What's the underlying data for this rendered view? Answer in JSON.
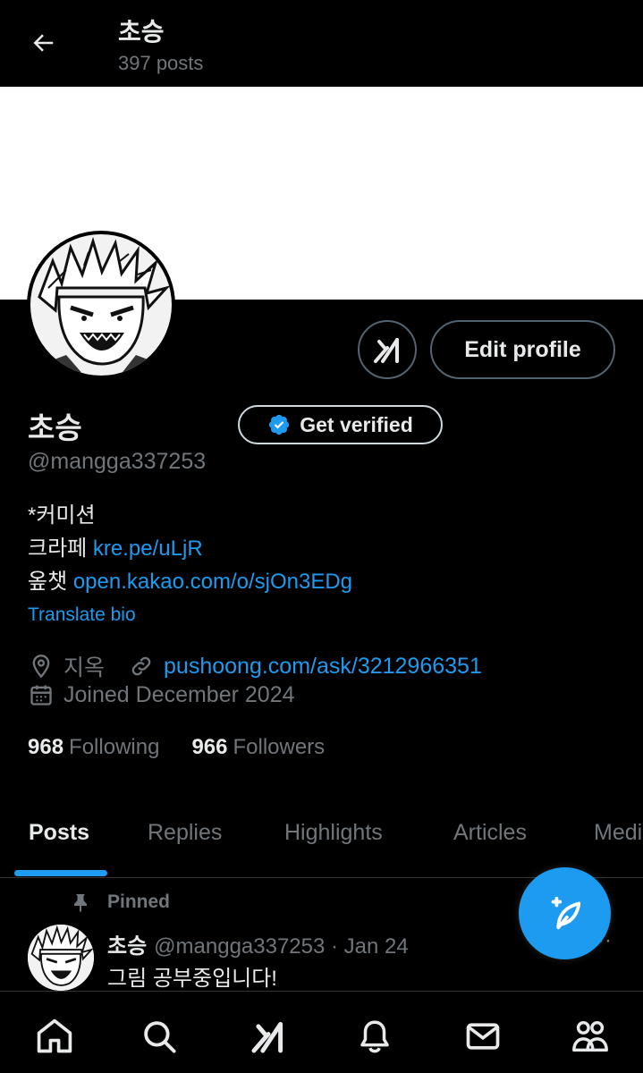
{
  "header": {
    "title": "초승",
    "post_count": "397 posts"
  },
  "profile": {
    "display_name": "초승",
    "handle": "@mangga337253",
    "edit_label": "Edit profile",
    "verify_label": "Get verified",
    "bio": {
      "line1": "*커미션",
      "line2_prefix": "크라페 ",
      "line2_link": "kre.pe/uLjR",
      "line3_prefix": "옾챗 ",
      "line3_link": "open.kakao.com/o/sjOn3EDg"
    },
    "translate_label": "Translate bio",
    "location": "지옥",
    "website": "pushoong.com/ask/3212966351",
    "joined": "Joined December 2024",
    "following_count": "968",
    "following_label": "Following",
    "followers_count": "966",
    "followers_label": "Followers"
  },
  "tabs": [
    {
      "label": "Posts",
      "active": true
    },
    {
      "label": "Replies"
    },
    {
      "label": "Highlights"
    },
    {
      "label": "Articles"
    },
    {
      "label": "Media"
    }
  ],
  "pinned_post": {
    "pinned_label": "Pinned",
    "author_name": "초승",
    "author_meta": "@mangga337253 · Jan 24",
    "text": "그림 공부중입니다!",
    "more": "···"
  },
  "bottom_nav": [
    "home-icon",
    "search-icon",
    "grok-icon",
    "bell-icon",
    "mail-icon",
    "communities-icon"
  ],
  "colors": {
    "background": "#000000",
    "accent": "#1d9bf0",
    "muted": "#71767b",
    "text": "#e7e9ea"
  }
}
